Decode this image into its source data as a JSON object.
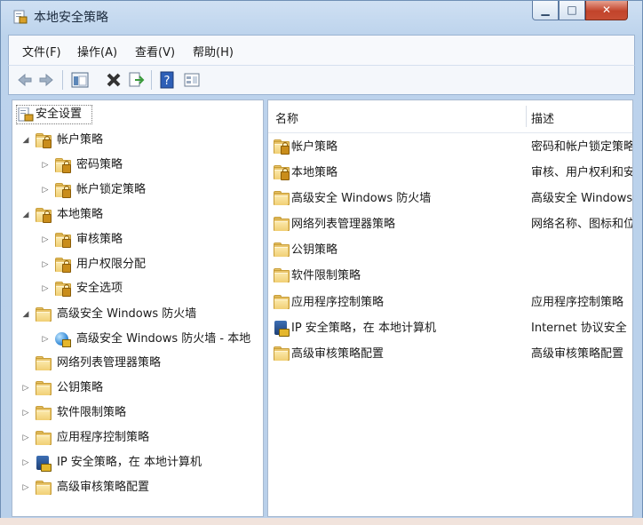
{
  "window": {
    "title": "本地安全策略"
  },
  "caption_buttons": {
    "minimize": "▁",
    "maximize": "□",
    "close": "✕"
  },
  "menu": [
    {
      "label": "文件(F)"
    },
    {
      "label": "操作(A)"
    },
    {
      "label": "查看(V)"
    },
    {
      "label": "帮助(H)"
    }
  ],
  "toolbar": {
    "icons": [
      "back-icon",
      "forward-icon",
      "show-hide-tree-icon",
      "delete-icon",
      "export-list-icon",
      "help-icon",
      "properties-icon"
    ]
  },
  "tree": {
    "items": [
      {
        "label": "安全设置",
        "arrow": "",
        "icon": "security-settings-icon",
        "selected": true
      },
      {
        "label": "帐户策略",
        "arrow": "◢",
        "icon": "folder-lock-icon"
      },
      {
        "label": "密码策略",
        "arrow": "▷",
        "icon": "folder-lock-icon"
      },
      {
        "label": "帐户锁定策略",
        "arrow": "▷",
        "icon": "folder-lock-icon"
      },
      {
        "label": "本地策略",
        "arrow": "◢",
        "icon": "folder-lock-icon"
      },
      {
        "label": "审核策略",
        "arrow": "▷",
        "icon": "folder-lock-icon"
      },
      {
        "label": "用户权限分配",
        "arrow": "▷",
        "icon": "folder-lock-icon"
      },
      {
        "label": "安全选项",
        "arrow": "▷",
        "icon": "folder-lock-icon"
      },
      {
        "label": "高级安全 Windows 防火墙",
        "arrow": "◢",
        "icon": "folder-icon"
      },
      {
        "label": "高级安全 Windows 防火墙 - 本地",
        "arrow": "▷",
        "icon": "firewall-globe-icon"
      },
      {
        "label": "网络列表管理器策略",
        "arrow": "",
        "icon": "folder-icon"
      },
      {
        "label": "公钥策略",
        "arrow": "▷",
        "icon": "folder-icon"
      },
      {
        "label": "软件限制策略",
        "arrow": "▷",
        "icon": "folder-icon"
      },
      {
        "label": "应用程序控制策略",
        "arrow": "▷",
        "icon": "folder-icon"
      },
      {
        "label": "IP 安全策略，在 本地计算机",
        "arrow": "▷",
        "icon": "ip-security-icon"
      },
      {
        "label": "高级审核策略配置",
        "arrow": "▷",
        "icon": "folder-icon"
      }
    ]
  },
  "list": {
    "columns": {
      "name": "名称",
      "description": "描述"
    },
    "rows": [
      {
        "name": "帐户策略",
        "description": "密码和帐户锁定策略",
        "icon": "folder-lock-icon"
      },
      {
        "name": "本地策略",
        "description": "审核、用户权利和安全",
        "icon": "folder-lock-icon"
      },
      {
        "name": "高级安全 Windows 防火墙",
        "description": "高级安全 Windows",
        "icon": "folder-icon"
      },
      {
        "name": "网络列表管理器策略",
        "description": "网络名称、图标和位置",
        "icon": "folder-icon"
      },
      {
        "name": "公钥策略",
        "description": "",
        "icon": "folder-icon"
      },
      {
        "name": "软件限制策略",
        "description": "",
        "icon": "folder-icon"
      },
      {
        "name": "应用程序控制策略",
        "description": "应用程序控制策略",
        "icon": "folder-icon"
      },
      {
        "name": "IP 安全策略，在 本地计算机",
        "description": "Internet 协议安全",
        "icon": "ip-security-icon"
      },
      {
        "name": "高级审核策略配置",
        "description": "高级审核策略配置",
        "icon": "folder-icon"
      }
    ]
  },
  "colors": {
    "frame": "#b9d0ea",
    "close_button": "#c2442b",
    "folder": "#e9c56b"
  }
}
